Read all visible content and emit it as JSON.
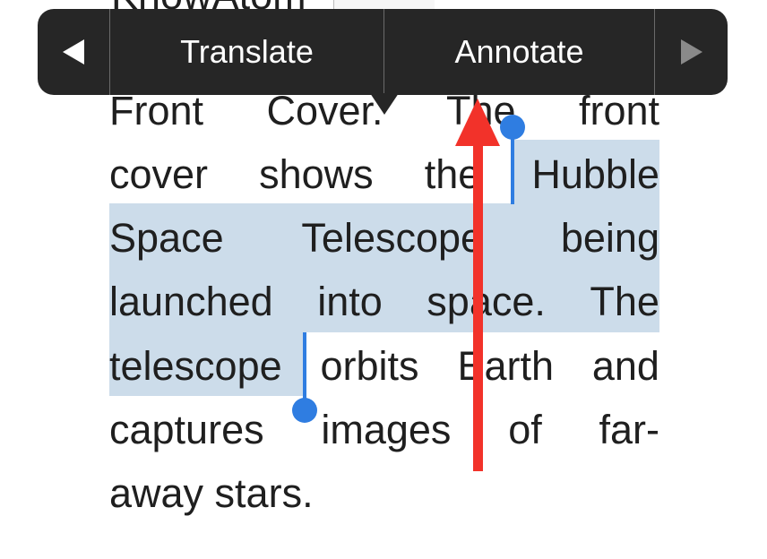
{
  "header_fragment": "KnowAtom",
  "menu": {
    "prev_icon": "triangle-left-icon",
    "translate_label": "Translate",
    "annotate_label": "Annotate",
    "next_icon": "triangle-right-icon"
  },
  "text": {
    "line1": [
      "Front",
      "Cover.",
      "The",
      "front"
    ],
    "line2": [
      "cover",
      "shows",
      "the",
      "Hubble"
    ],
    "line3": [
      "Space",
      "Telescope",
      "being"
    ],
    "line4": [
      "launched",
      "into",
      "space.",
      "The"
    ],
    "line5": [
      "telescope",
      "orbits",
      "Earth",
      "and"
    ],
    "line6": [
      "captures",
      "images",
      "of",
      "far-"
    ],
    "line7": "away stars."
  },
  "colors": {
    "menu_bg": "#262626",
    "selection": "#ccdcea",
    "handle": "#2f7de1",
    "annotation_arrow": "#f2322a"
  }
}
